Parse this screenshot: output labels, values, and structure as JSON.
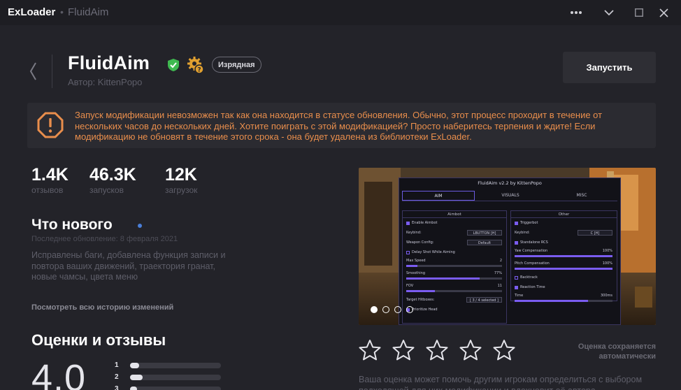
{
  "titlebar": {
    "app_name": "ExLoader",
    "separator": "•",
    "page_title": "FluidAim",
    "buttons": [
      "more-icon",
      "chevron-down-icon",
      "maximize-icon",
      "close-icon"
    ]
  },
  "header": {
    "title": "FluidAim",
    "author": "Автор: KittenPopo",
    "badge": "Изрядная",
    "launch_label": "Запустить",
    "colors": {
      "shield": "#3fb950",
      "gear": "#e0a030"
    }
  },
  "warning": {
    "icon": "warning-icon",
    "color": "#e98e4c",
    "text": "Запуск модификации невозможен так как она находится в статусе обновления. Обычно, этот процесс проходит в течение от нескольких часов до нескольких дней. Хотите поиграть с этой модификацией? Просто наберитесь терпения и ждите! Если модификацию не обновят в течение этого срока - она будет удалена из библиотеки ExLoader."
  },
  "stats": [
    {
      "value": "1.4K",
      "label": "отзывов"
    },
    {
      "value": "46.3K",
      "label": "запусков"
    },
    {
      "value": "12K",
      "label": "загрузок"
    }
  ],
  "whats_new": {
    "title": "Что нового",
    "last_update": "Последнее обновление: 8 февраля 2021",
    "text": "Исправлены баги, добавлена функция записи и повтора ваших движений, траектория гранат, новые чамсы, цвета меню",
    "history_link": "Посмотреть всю историю изменений"
  },
  "gallery": {
    "slide_count": 4,
    "active_index": 0,
    "menu": {
      "title": "FluidAim v2.2 by KittenPopo",
      "tabs": [
        "AIM",
        "VISUALS",
        "MISC"
      ],
      "left_header": "Aimbot",
      "right_header": "Other",
      "left_rows": [
        {
          "label": "Enable Aimbot",
          "kind": "check"
        },
        {
          "label": "Keybind:",
          "kind": "key",
          "value": "LBUTTON",
          "mode": "[H]"
        },
        {
          "label": "Weapon Config:",
          "kind": "combo",
          "value": "Default"
        },
        {
          "label": "Delay Shot While Aiming",
          "kind": "check-off"
        },
        {
          "label": "Max Speed",
          "kind": "slider",
          "value": "2",
          "fill": 0.12
        },
        {
          "label": "Smoothing",
          "kind": "slider",
          "value": "77%",
          "fill": 0.77
        },
        {
          "label": "FOV",
          "kind": "slider",
          "value": "11",
          "fill": 0.3
        },
        {
          "label": "Target Hitboxes:",
          "kind": "combo",
          "value": "[ 3 / 4 selected ]"
        },
        {
          "label": "Prioritize Head",
          "kind": "check"
        }
      ],
      "right_rows": [
        {
          "label": "Triggerbot",
          "kind": "check"
        },
        {
          "label": "Keybind:",
          "kind": "key",
          "value": "C",
          "mode": "[H]"
        },
        {
          "label": "Standalone RCS",
          "kind": "check"
        },
        {
          "label": "Yaw Compensation",
          "kind": "slider",
          "value": "100%",
          "fill": 1.0
        },
        {
          "label": "Pitch Compensation",
          "kind": "slider",
          "value": "100%",
          "fill": 1.0
        },
        {
          "label": "Backtrack",
          "kind": "check-off"
        },
        {
          "label": "Reaction Time",
          "kind": "check"
        },
        {
          "label": "Time",
          "kind": "slider",
          "value": "300ms",
          "fill": 0.75
        }
      ],
      "accent": "#7a5cf0"
    }
  },
  "reviews": {
    "title": "Оценки и отзывы",
    "average": "4.0",
    "breakdown": [
      {
        "stars": "1",
        "fraction": 0.1
      },
      {
        "stars": "2",
        "fraction": 0.14
      },
      {
        "stars": "3",
        "fraction": 0.08
      }
    ],
    "user_stars": 5,
    "saved_note": "Оценка сохраняется автоматически",
    "help_text": "Ваша оценка может помочь другим игрокам определиться с выбором подходящей для них модификации и вдохновит её автора"
  }
}
